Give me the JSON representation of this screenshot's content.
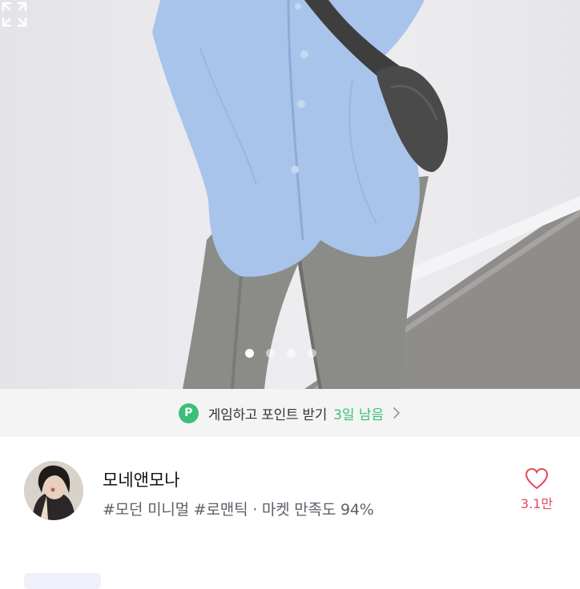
{
  "gallery": {
    "image_alt": "상품 사진 - 하늘색 셔츠와 회색 슬랙스",
    "pages": 4,
    "current_page": 1,
    "expand_icon": "expand-icon"
  },
  "banner": {
    "badge": "P",
    "text": "게임하고 포인트 받기",
    "days_left": "3일 남음",
    "icon": "chevron-right-icon"
  },
  "seller": {
    "name": "모네앤모나",
    "tags": "#모던 미니멀 #로맨틱 · 마켓 만족도 94%",
    "avatar_icon": "avatar"
  },
  "like": {
    "icon": "heart-icon",
    "count": "3.1만",
    "color": "#e64a5a"
  },
  "colors": {
    "accent_green": "#3cbf75",
    "banner_bg": "#f4f4f4"
  }
}
